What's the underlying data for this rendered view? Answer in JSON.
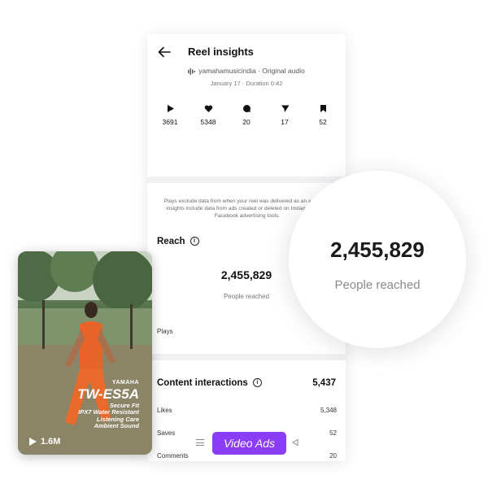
{
  "header": {
    "title": "Reel insights",
    "account_audio": "yamahamusicindia · Original audio",
    "date_duration": "January 17 · Duration 0:42"
  },
  "stats": [
    {
      "icon": "play-icon",
      "value": "3691"
    },
    {
      "icon": "heart-icon",
      "value": "5348"
    },
    {
      "icon": "comment-icon",
      "value": "20"
    },
    {
      "icon": "send-icon",
      "value": "17"
    },
    {
      "icon": "bookmark-icon",
      "value": "52"
    }
  ],
  "note": "Plays exclude data from when your reel was delivered as an ad. Other insights include data from ads created or deleted on Instagram or on Facebook advertising tools.",
  "reach": {
    "title": "Reach",
    "value": "2,455,829",
    "label": "People reached",
    "plays_label": "Plays"
  },
  "interactions": {
    "title": "Content interactions",
    "total": "5,437",
    "rows": [
      {
        "label": "Likes",
        "value": "5,348"
      },
      {
        "label": "Saves",
        "value": "52"
      },
      {
        "label": "Comments",
        "value": "20"
      }
    ]
  },
  "navbar": {
    "video_ads_label": "Video Ads"
  },
  "magnifier": {
    "value": "2,455,829",
    "label": "People reached"
  },
  "video": {
    "brand": "YAMAHA",
    "model": "TW-ES5A",
    "features": [
      "Secure Fit",
      "IPX7 Water Resistant",
      "Listening Care",
      "Ambient Sound"
    ],
    "views": "1.6M"
  },
  "colors": {
    "accent": "#8b3cf6",
    "background": "#f1f1f4"
  }
}
